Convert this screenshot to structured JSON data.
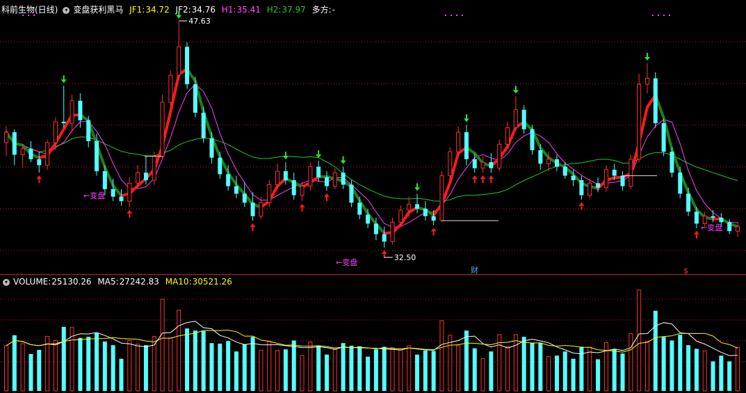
{
  "header": {
    "stock_name": "科前生物(日线)",
    "indicator_name": "变盘获利黑马",
    "jf1_label": "JF1:",
    "jf1_value": "34.72",
    "jf2_label": "JF2:",
    "jf2_value": "34.76",
    "h1_label": "H1:",
    "h1_value": "35.41",
    "h2_label": "H2:",
    "h2_value": "37.97",
    "trend_label": "多方:",
    "trend_value": "-"
  },
  "volume_header": {
    "volume_label": "VOLUME:",
    "volume_value": "25130.26",
    "ma5_label": "MA5:",
    "ma5_value": "27242.83",
    "ma10_label": "MA10:",
    "ma10_value": "30521.26"
  },
  "annotations": {
    "high_price": "47.63",
    "low_price": "32.50",
    "turn_text": "变盘",
    "finance_marker": "财",
    "dividend_marker": "$"
  },
  "colors": {
    "background": "#000000",
    "up_candle": "#ff3232",
    "down_candle": "#54ffff",
    "ma_green": "#28c828",
    "ma_magenta": "#ff40ff",
    "trend_red": "#ff1a1a",
    "trend_green": "#1e7d1e",
    "volume_ma5": "#ffffff",
    "volume_ma10": "#ffff00",
    "grid_red": "#c81e1e",
    "header_white": "#ffffff",
    "header_yellow": "#ffff00",
    "header_magenta": "#ff50ff",
    "header_green": "#28c828"
  },
  "chart_data": {
    "type": "candlestick",
    "price_markers": {
      "high": 47.63,
      "low": 32.5
    },
    "volume_latest": 25130.26,
    "volume_ma5": 27242.83,
    "volume_ma10": 30521.26,
    "indicator_values": {
      "JF1": 34.72,
      "JF2": 34.76,
      "H1": 35.41,
      "H2": 37.97
    },
    "ohlc_note": "approximate OHLC read from candle shapes",
    "candles": [
      [
        39.5,
        40.6,
        38.6,
        40.2
      ],
      [
        40.2,
        40.4,
        38.0,
        38.7
      ],
      [
        38.7,
        39.4,
        37.8,
        39.1
      ],
      [
        39.1,
        39.6,
        38.2,
        38.4
      ],
      [
        38.4,
        38.9,
        37.5,
        38.0
      ],
      [
        38.0,
        39.7,
        37.7,
        39.5
      ],
      [
        39.5,
        41.2,
        39.0,
        40.9
      ],
      [
        40.9,
        43.3,
        40.5,
        40.8
      ],
      [
        40.8,
        42.7,
        40.2,
        42.3
      ],
      [
        42.3,
        42.8,
        40.5,
        41.0
      ],
      [
        41.0,
        41.3,
        39.2,
        39.6
      ],
      [
        39.6,
        40.1,
        37.3,
        37.6
      ],
      [
        37.6,
        38.0,
        36.0,
        36.4
      ],
      [
        36.4,
        37.1,
        35.6,
        35.9
      ],
      [
        35.9,
        36.4,
        35.3,
        35.6
      ],
      [
        35.6,
        37.2,
        35.2,
        36.8
      ],
      [
        36.8,
        38.0,
        36.5,
        37.5
      ],
      [
        37.5,
        38.6,
        36.7,
        37.0
      ],
      [
        37.0,
        38.9,
        36.7,
        38.6
      ],
      [
        38.6,
        42.7,
        38.4,
        42.2
      ],
      [
        42.2,
        44.3,
        42.0,
        44.0
      ],
      [
        44.0,
        47.6,
        43.8,
        45.9
      ],
      [
        45.9,
        46.2,
        43.1,
        43.4
      ],
      [
        43.4,
        43.9,
        41.2,
        41.5
      ],
      [
        41.5,
        41.9,
        39.5,
        39.8
      ],
      [
        39.8,
        40.2,
        38.1,
        38.5
      ],
      [
        38.5,
        38.9,
        37.1,
        37.4
      ],
      [
        37.4,
        38.0,
        36.3,
        36.6
      ],
      [
        36.6,
        37.3,
        35.8,
        36.1
      ],
      [
        36.1,
        36.9,
        35.2,
        35.5
      ],
      [
        35.5,
        36.2,
        34.3,
        34.6
      ],
      [
        34.6,
        35.9,
        34.4,
        35.5
      ],
      [
        35.5,
        37.0,
        35.2,
        36.7
      ],
      [
        36.7,
        38.1,
        36.4,
        37.6
      ],
      [
        37.6,
        38.2,
        36.7,
        37.0
      ],
      [
        37.0,
        37.5,
        35.7,
        36.0
      ],
      [
        36.0,
        36.9,
        35.6,
        36.6
      ],
      [
        36.6,
        38.2,
        36.3,
        37.9
      ],
      [
        37.9,
        38.3,
        36.9,
        37.2
      ],
      [
        37.2,
        37.6,
        36.3,
        36.6
      ],
      [
        36.6,
        37.8,
        36.4,
        37.5
      ],
      [
        37.5,
        37.9,
        36.4,
        36.7
      ],
      [
        36.7,
        37.0,
        35.2,
        35.5
      ],
      [
        35.5,
        35.9,
        34.4,
        34.7
      ],
      [
        34.7,
        35.1,
        33.8,
        34.1
      ],
      [
        34.1,
        34.5,
        33.0,
        33.4
      ],
      [
        33.4,
        33.9,
        32.5,
        32.9
      ],
      [
        32.9,
        34.5,
        32.7,
        34.2
      ],
      [
        34.2,
        35.3,
        33.9,
        35.0
      ],
      [
        35.0,
        35.9,
        34.5,
        35.4
      ],
      [
        35.4,
        36.1,
        34.8,
        35.1
      ],
      [
        35.1,
        35.6,
        34.3,
        34.6
      ],
      [
        34.6,
        35.0,
        34.0,
        34.3
      ],
      [
        34.3,
        37.6,
        34.2,
        37.3
      ],
      [
        37.3,
        39.2,
        37.0,
        38.9
      ],
      [
        38.9,
        40.6,
        38.6,
        40.2
      ],
      [
        40.2,
        40.7,
        38.0,
        38.4
      ],
      [
        38.4,
        38.8,
        37.5,
        37.8
      ],
      [
        37.8,
        38.6,
        37.5,
        38.2
      ],
      [
        38.2,
        38.8,
        37.5,
        37.8
      ],
      [
        37.8,
        39.7,
        37.6,
        39.4
      ],
      [
        39.4,
        40.9,
        39.1,
        40.5
      ],
      [
        40.5,
        42.6,
        40.3,
        41.7
      ],
      [
        41.7,
        42.0,
        40.1,
        40.4
      ],
      [
        40.4,
        40.7,
        38.7,
        39.0
      ],
      [
        39.0,
        39.4,
        37.7,
        38.1
      ],
      [
        38.1,
        38.9,
        37.6,
        38.4
      ],
      [
        38.4,
        38.7,
        37.6,
        37.9
      ],
      [
        37.9,
        38.2,
        37.1,
        37.3
      ],
      [
        37.3,
        37.7,
        36.6,
        37.0
      ],
      [
        37.0,
        37.3,
        35.7,
        36.0
      ],
      [
        36.0,
        37.1,
        35.8,
        36.8
      ],
      [
        36.8,
        37.2,
        36.2,
        36.5
      ],
      [
        36.5,
        38.0,
        36.2,
        37.7
      ],
      [
        37.7,
        38.1,
        37.0,
        37.3
      ],
      [
        37.3,
        37.6,
        36.3,
        36.6
      ],
      [
        36.6,
        38.7,
        36.4,
        38.4
      ],
      [
        38.4,
        44.1,
        38.2,
        43.4
      ],
      [
        43.4,
        44.8,
        42.8,
        43.8
      ],
      [
        43.8,
        44.2,
        40.5,
        40.8
      ],
      [
        40.8,
        41.1,
        38.6,
        38.9
      ],
      [
        38.9,
        39.2,
        37.2,
        37.5
      ],
      [
        37.5,
        37.9,
        35.8,
        36.1
      ],
      [
        36.1,
        36.5,
        34.6,
        34.9
      ],
      [
        34.9,
        35.2,
        33.8,
        34.1
      ],
      [
        34.1,
        34.9,
        33.9,
        34.6
      ],
      [
        34.6,
        35.0,
        34.2,
        34.5
      ],
      [
        34.5,
        34.8,
        33.9,
        34.2
      ],
      [
        34.2,
        34.4,
        33.4,
        33.6
      ],
      [
        33.6,
        34.2,
        33.2,
        33.9
      ]
    ]
  }
}
